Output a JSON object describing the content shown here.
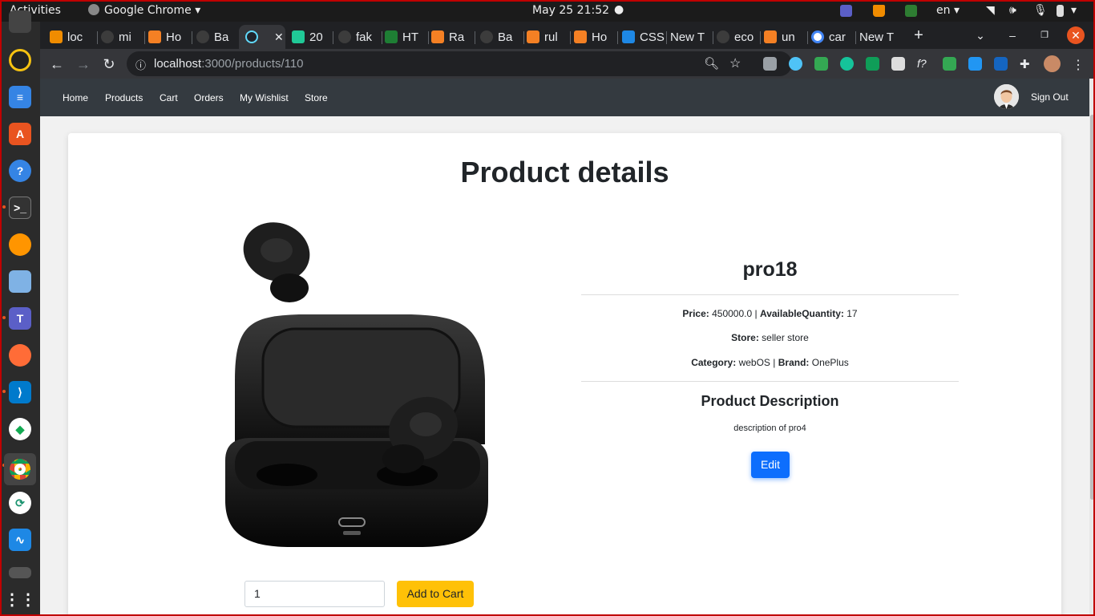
{
  "system": {
    "activities": "Activities",
    "app_name": "Google Chrome",
    "clock": "May 25  21:52",
    "lang": "en",
    "colors": {
      "red_frame": "#c00000",
      "ubuntu_orange": "#e95420"
    }
  },
  "dock": {
    "items": [
      "rhythmbox",
      "text-editor",
      "software-center",
      "help",
      "terminal",
      "firefox-dev",
      "virtualbox",
      "teams",
      "postman",
      "vscode",
      "mongodb-compass",
      "chrome",
      "sync-app",
      "system-monitor",
      "files"
    ]
  },
  "browser": {
    "tabs": [
      {
        "label": "loc",
        "icon": "vlc-icon"
      },
      {
        "label": "mi",
        "icon": "github-icon"
      },
      {
        "label": "Ho",
        "icon": "stackoverflow-icon"
      },
      {
        "label": "Ba",
        "icon": "github-icon"
      },
      {
        "label": "",
        "icon": "react-icon",
        "active": true
      },
      {
        "label": "20",
        "icon": "d-icon"
      },
      {
        "label": "fak",
        "icon": "github-icon"
      },
      {
        "label": "HT",
        "icon": "w-icon"
      },
      {
        "label": "Ra",
        "icon": "stackoverflow-icon"
      },
      {
        "label": "Ba",
        "icon": "github-icon"
      },
      {
        "label": "rul",
        "icon": "stackoverflow-icon"
      },
      {
        "label": "Ho",
        "icon": "stackoverflow-icon"
      },
      {
        "label": "CSS",
        "icon": "w3-icon"
      },
      {
        "label": "New T",
        "icon": ""
      },
      {
        "label": "eco",
        "icon": "github-icon"
      },
      {
        "label": "un",
        "icon": "stackoverflow-icon"
      },
      {
        "label": "car",
        "icon": "google-icon"
      },
      {
        "label": "New T",
        "icon": ""
      }
    ],
    "url_host": "localhost",
    "url_path": ":3000/products/110"
  },
  "app": {
    "nav": {
      "home": "Home",
      "products": "Products",
      "cart": "Cart",
      "orders": "Orders",
      "wishlist": "My Wishlist",
      "store": "Store",
      "signout": "Sign Out"
    },
    "page_title": "Product details",
    "product": {
      "name": "pro18",
      "price_label": "Price:",
      "price": "450000.0",
      "qty_label": "AvailableQuantity:",
      "qty": "17",
      "store_label": "Store:",
      "store": "seller store",
      "category_label": "Category:",
      "category": "webOS",
      "brand_label": "Brand:",
      "brand": "OnePlus",
      "description_heading": "Product Description",
      "description": "description of pro4"
    },
    "edit_label": "Edit",
    "quantity_value": "1",
    "add_to_cart_label": "Add to Cart",
    "colors": {
      "navbar": "#343a40",
      "primary": "#0d6efd",
      "warning": "#ffc107"
    }
  }
}
